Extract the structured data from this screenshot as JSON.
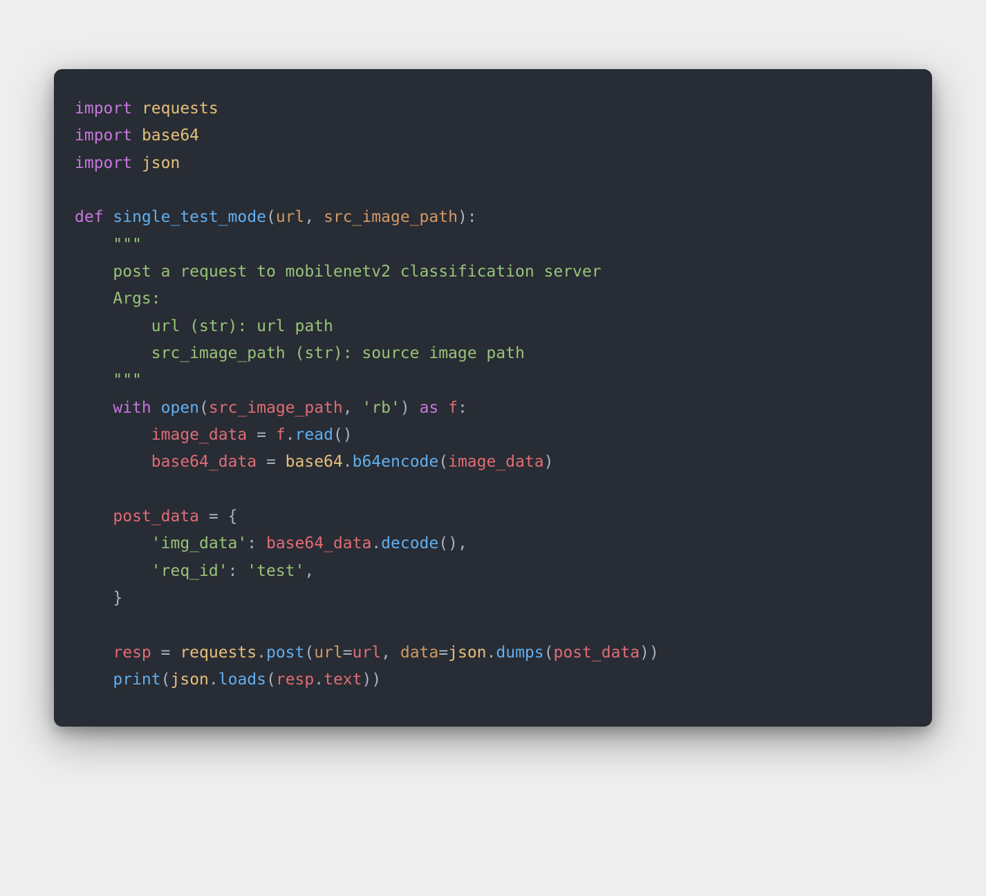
{
  "code": {
    "tokens": [
      [
        {
          "t": "import ",
          "c": "kw"
        },
        {
          "t": "requests",
          "c": "mod"
        }
      ],
      [
        {
          "t": "import ",
          "c": "kw"
        },
        {
          "t": "base64",
          "c": "mod"
        }
      ],
      [
        {
          "t": "import ",
          "c": "kw"
        },
        {
          "t": "json",
          "c": "mod"
        }
      ],
      [],
      [
        {
          "t": "def ",
          "c": "kw"
        },
        {
          "t": "single_test_mode",
          "c": "fn"
        },
        {
          "t": "(",
          "c": "txt"
        },
        {
          "t": "url",
          "c": "pr"
        },
        {
          "t": ", ",
          "c": "txt"
        },
        {
          "t": "src_image_path",
          "c": "pr"
        },
        {
          "t": "):",
          "c": "txt"
        }
      ],
      [
        {
          "t": "    \"\"\"",
          "c": "str"
        }
      ],
      [
        {
          "t": "    post a request to mobilenetv2 classification server",
          "c": "str"
        }
      ],
      [
        {
          "t": "    Args:",
          "c": "str"
        }
      ],
      [
        {
          "t": "        url (str): url path",
          "c": "str"
        }
      ],
      [
        {
          "t": "        src_image_path (str): source image path",
          "c": "str"
        }
      ],
      [
        {
          "t": "    \"\"\"",
          "c": "str"
        }
      ],
      [
        {
          "t": "    ",
          "c": "txt"
        },
        {
          "t": "with ",
          "c": "kw"
        },
        {
          "t": "open",
          "c": "fn"
        },
        {
          "t": "(",
          "c": "txt"
        },
        {
          "t": "src_image_path",
          "c": "var"
        },
        {
          "t": ", ",
          "c": "txt"
        },
        {
          "t": "'rb'",
          "c": "str"
        },
        {
          "t": ") ",
          "c": "txt"
        },
        {
          "t": "as ",
          "c": "kw"
        },
        {
          "t": "f",
          "c": "var"
        },
        {
          "t": ":",
          "c": "txt"
        }
      ],
      [
        {
          "t": "        ",
          "c": "txt"
        },
        {
          "t": "image_data",
          "c": "var"
        },
        {
          "t": " = ",
          "c": "txt"
        },
        {
          "t": "f",
          "c": "var"
        },
        {
          "t": ".",
          "c": "txt"
        },
        {
          "t": "read",
          "c": "fn"
        },
        {
          "t": "()",
          "c": "txt"
        }
      ],
      [
        {
          "t": "        ",
          "c": "txt"
        },
        {
          "t": "base64_data",
          "c": "var"
        },
        {
          "t": " = ",
          "c": "txt"
        },
        {
          "t": "base64",
          "c": "mod"
        },
        {
          "t": ".",
          "c": "txt"
        },
        {
          "t": "b64encode",
          "c": "fn"
        },
        {
          "t": "(",
          "c": "txt"
        },
        {
          "t": "image_data",
          "c": "var"
        },
        {
          "t": ")",
          "c": "txt"
        }
      ],
      [],
      [
        {
          "t": "    ",
          "c": "txt"
        },
        {
          "t": "post_data",
          "c": "var"
        },
        {
          "t": " = {",
          "c": "txt"
        }
      ],
      [
        {
          "t": "        ",
          "c": "txt"
        },
        {
          "t": "'img_data'",
          "c": "str"
        },
        {
          "t": ": ",
          "c": "txt"
        },
        {
          "t": "base64_data",
          "c": "var"
        },
        {
          "t": ".",
          "c": "txt"
        },
        {
          "t": "decode",
          "c": "fn"
        },
        {
          "t": "(),",
          "c": "txt"
        }
      ],
      [
        {
          "t": "        ",
          "c": "txt"
        },
        {
          "t": "'req_id'",
          "c": "str"
        },
        {
          "t": ": ",
          "c": "txt"
        },
        {
          "t": "'test'",
          "c": "str"
        },
        {
          "t": ",",
          "c": "txt"
        }
      ],
      [
        {
          "t": "    }",
          "c": "txt"
        }
      ],
      [],
      [
        {
          "t": "    ",
          "c": "txt"
        },
        {
          "t": "resp",
          "c": "var"
        },
        {
          "t": " = ",
          "c": "txt"
        },
        {
          "t": "requests",
          "c": "mod"
        },
        {
          "t": ".",
          "c": "txt"
        },
        {
          "t": "post",
          "c": "fn"
        },
        {
          "t": "(",
          "c": "txt"
        },
        {
          "t": "url",
          "c": "pr"
        },
        {
          "t": "=",
          "c": "txt"
        },
        {
          "t": "url",
          "c": "var"
        },
        {
          "t": ", ",
          "c": "txt"
        },
        {
          "t": "data",
          "c": "pr"
        },
        {
          "t": "=",
          "c": "txt"
        },
        {
          "t": "json",
          "c": "mod"
        },
        {
          "t": ".",
          "c": "txt"
        },
        {
          "t": "dumps",
          "c": "fn"
        },
        {
          "t": "(",
          "c": "txt"
        },
        {
          "t": "post_data",
          "c": "var"
        },
        {
          "t": "))",
          "c": "txt"
        }
      ],
      [
        {
          "t": "    ",
          "c": "txt"
        },
        {
          "t": "print",
          "c": "fn"
        },
        {
          "t": "(",
          "c": "txt"
        },
        {
          "t": "json",
          "c": "mod"
        },
        {
          "t": ".",
          "c": "txt"
        },
        {
          "t": "loads",
          "c": "fn"
        },
        {
          "t": "(",
          "c": "txt"
        },
        {
          "t": "resp",
          "c": "var"
        },
        {
          "t": ".",
          "c": "txt"
        },
        {
          "t": "text",
          "c": "var"
        },
        {
          "t": "))",
          "c": "txt"
        }
      ]
    ]
  }
}
